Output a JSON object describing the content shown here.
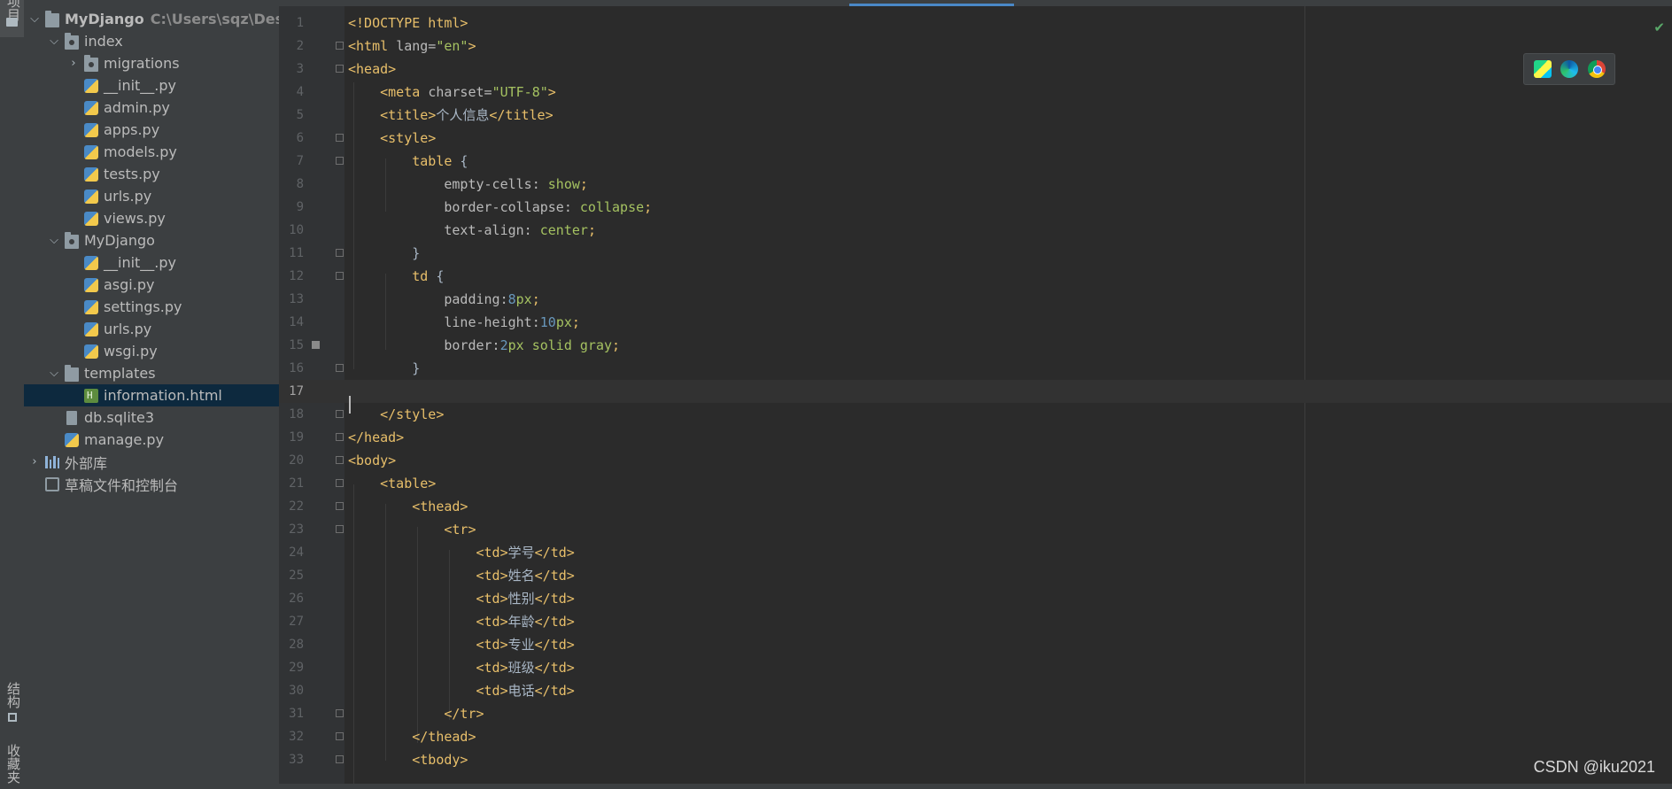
{
  "left_strip": {
    "project_label": "项目",
    "structure_label": "结构",
    "favorites_label": "收藏夹"
  },
  "tree": {
    "root": {
      "name": "MyDjango",
      "path": "C:\\Users\\sqz\\Deskto"
    },
    "items": [
      {
        "label": "index",
        "kind": "package",
        "expanded": true
      },
      {
        "label": "migrations",
        "kind": "package",
        "expanded": false
      },
      {
        "label": "__init__.py",
        "kind": "python"
      },
      {
        "label": "admin.py",
        "kind": "python"
      },
      {
        "label": "apps.py",
        "kind": "python"
      },
      {
        "label": "models.py",
        "kind": "python"
      },
      {
        "label": "tests.py",
        "kind": "python"
      },
      {
        "label": "urls.py",
        "kind": "python"
      },
      {
        "label": "views.py",
        "kind": "python"
      },
      {
        "label": "MyDjango",
        "kind": "package",
        "expanded": true
      },
      {
        "label": "__init__.py",
        "kind": "python"
      },
      {
        "label": "asgi.py",
        "kind": "python"
      },
      {
        "label": "settings.py",
        "kind": "python"
      },
      {
        "label": "urls.py",
        "kind": "python"
      },
      {
        "label": "wsgi.py",
        "kind": "python"
      },
      {
        "label": "templates",
        "kind": "folder",
        "expanded": true
      },
      {
        "label": "information.html",
        "kind": "html",
        "selected": true
      },
      {
        "label": "db.sqlite3",
        "kind": "database"
      },
      {
        "label": "manage.py",
        "kind": "python"
      },
      {
        "label": "外部库",
        "kind": "library"
      },
      {
        "label": "草稿文件和控制台",
        "kind": "scratch"
      }
    ]
  },
  "editor": {
    "current_line": 17,
    "line_numbers": [
      "1",
      "2",
      "3",
      "4",
      "5",
      "6",
      "7",
      "8",
      "9",
      "10",
      "11",
      "12",
      "13",
      "14",
      "15",
      "16",
      "17",
      "18",
      "19",
      "20",
      "21",
      "22",
      "23",
      "24",
      "25",
      "26",
      "27",
      "28",
      "29",
      "30",
      "31",
      "32",
      "33"
    ],
    "code": {
      "l1": "<!DOCTYPE html>",
      "l2_tag": "<html ",
      "l2_attr": "lang=",
      "l2_val": "\"en\"",
      "l2_close": ">",
      "l3": "<head>",
      "l4_tag": "<meta ",
      "l4_attr": "charset=",
      "l4_val": "\"UTF-8\"",
      "l4_close": ">",
      "l5_open": "<title>",
      "l5_text": "个人信息",
      "l5_close": "</title>",
      "l6": "<style>",
      "l7_sel": "table",
      "l7_brace": " {",
      "l8_prop": "empty-cells: ",
      "l8_val": "show",
      "l8_semi": ";",
      "l9_prop": "border-collapse: ",
      "l9_val": "collapse",
      "l9_semi": ";",
      "l10_prop": "text-align: ",
      "l10_val": "center",
      "l10_semi": ";",
      "l11": "}",
      "l12_sel": "td",
      "l12_brace": " {",
      "l13_prop": "padding:",
      "l13_num": "8",
      "l13_unit": "px",
      "l13_semi": ";",
      "l14_prop": "line-height:",
      "l14_num": "10",
      "l14_unit": "px",
      "l14_semi": ";",
      "l15_prop": "border:",
      "l15_num": "2",
      "l15_val": "px solid gray",
      "l15_semi": ";",
      "l16": "}",
      "l18": "</style>",
      "l19": "</head>",
      "l20": "<body>",
      "l21": "<table>",
      "l22": "<thead>",
      "l23": "<tr>",
      "td_open": "<td>",
      "td_close": "</td>",
      "cells": [
        "学号",
        "姓名",
        "性别",
        "年龄",
        "专业",
        "班级",
        "电话"
      ],
      "l31": "</tr>",
      "l32": "</thead>",
      "l33": "<tbody>"
    }
  },
  "watermark": "CSDN @iku2021"
}
